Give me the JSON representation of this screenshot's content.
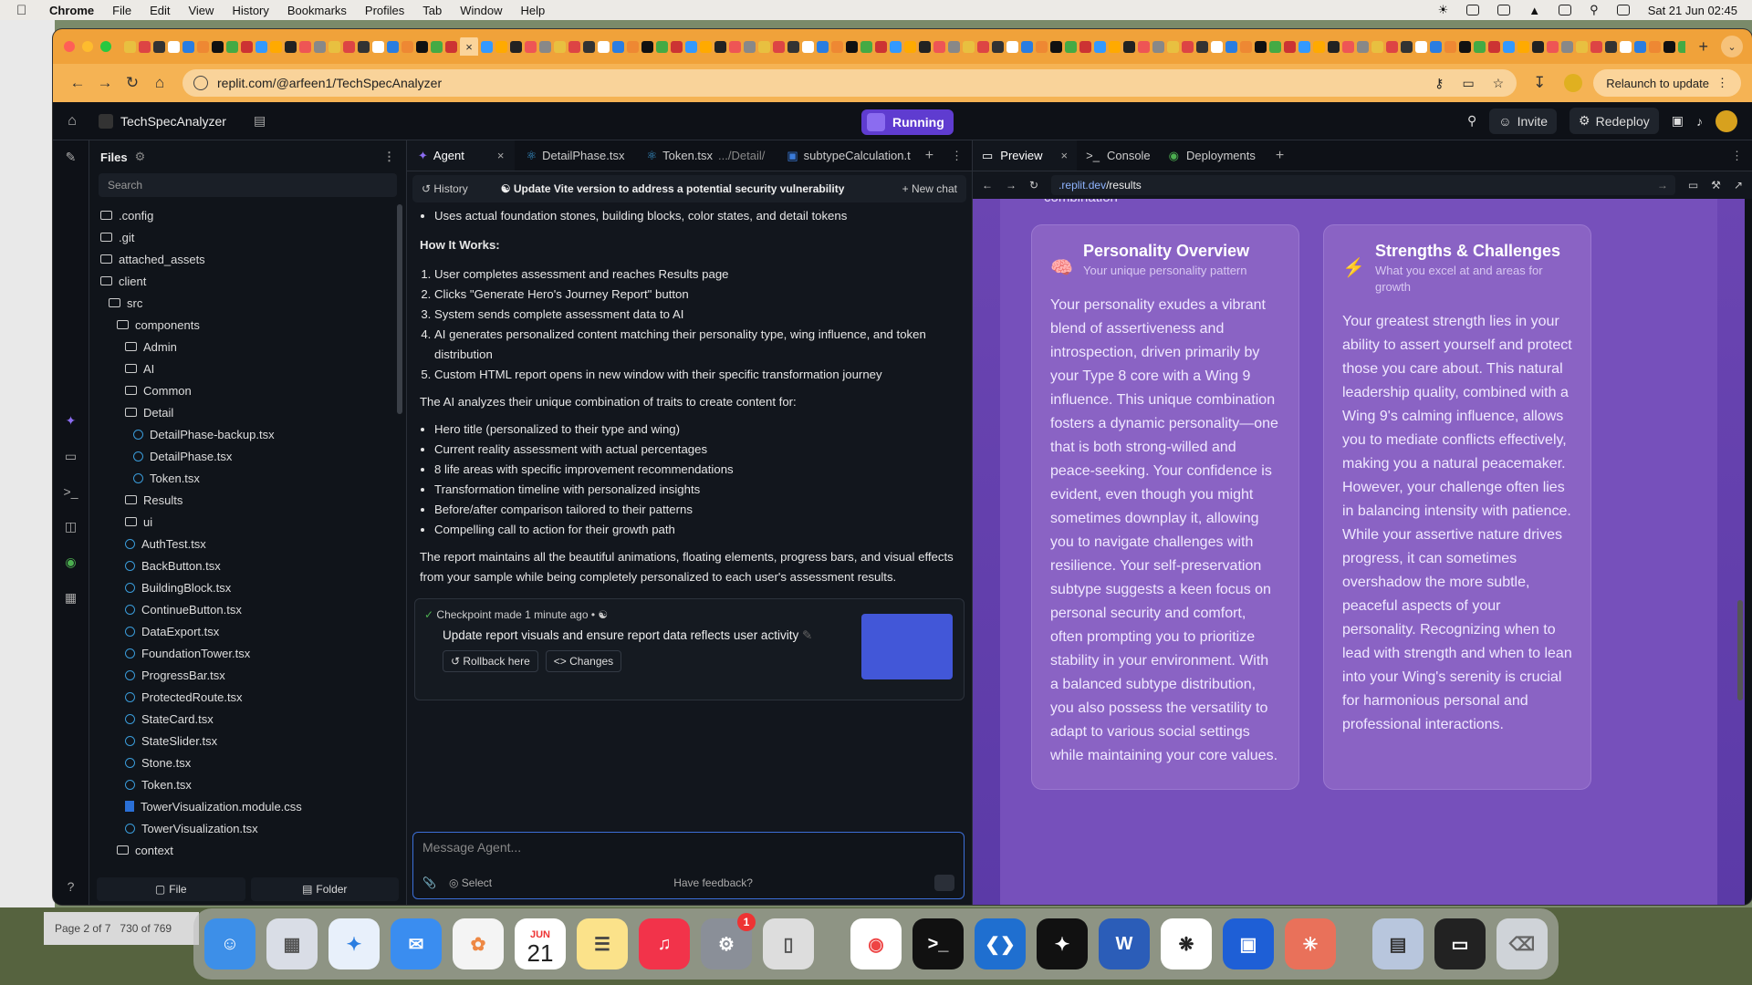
{
  "menubar": {
    "app": "Chrome",
    "items": [
      "File",
      "Edit",
      "View",
      "History",
      "Bookmarks",
      "Profiles",
      "Tab",
      "Window",
      "Help"
    ],
    "datetime": "Sat 21 Jun  02:45"
  },
  "browser": {
    "url_prefix": "replit.com/",
    "url_path": "@arfeen1/TechSpecAnalyzer",
    "relaunch_label": "Relaunch to update"
  },
  "replit": {
    "project_name": "TechSpecAnalyzer",
    "status": "Running",
    "invite_label": "Invite",
    "redeploy_label": "Redeploy"
  },
  "files": {
    "header": "Files",
    "search_placeholder": "Search",
    "tree": [
      {
        "name": ".config",
        "type": "folder",
        "depth": 0
      },
      {
        "name": ".git",
        "type": "folder",
        "depth": 0
      },
      {
        "name": "attached_assets",
        "type": "folder",
        "depth": 0
      },
      {
        "name": "client",
        "type": "folder",
        "depth": 0
      },
      {
        "name": "src",
        "type": "folder",
        "depth": 1
      },
      {
        "name": "components",
        "type": "folder",
        "depth": 2
      },
      {
        "name": "Admin",
        "type": "folder",
        "depth": 3
      },
      {
        "name": "AI",
        "type": "folder",
        "depth": 3
      },
      {
        "name": "Common",
        "type": "folder",
        "depth": 3
      },
      {
        "name": "Detail",
        "type": "folder",
        "depth": 3
      },
      {
        "name": "DetailPhase-backup.tsx",
        "type": "tsx",
        "depth": 4
      },
      {
        "name": "DetailPhase.tsx",
        "type": "tsx",
        "depth": 4
      },
      {
        "name": "Token.tsx",
        "type": "tsx",
        "depth": 4
      },
      {
        "name": "Results",
        "type": "folder",
        "depth": 3
      },
      {
        "name": "ui",
        "type": "folder",
        "depth": 3
      },
      {
        "name": "AuthTest.tsx",
        "type": "tsx",
        "depth": 3
      },
      {
        "name": "BackButton.tsx",
        "type": "tsx",
        "depth": 3
      },
      {
        "name": "BuildingBlock.tsx",
        "type": "tsx",
        "depth": 3
      },
      {
        "name": "ContinueButton.tsx",
        "type": "tsx",
        "depth": 3
      },
      {
        "name": "DataExport.tsx",
        "type": "tsx",
        "depth": 3
      },
      {
        "name": "FoundationTower.tsx",
        "type": "tsx",
        "depth": 3
      },
      {
        "name": "ProgressBar.tsx",
        "type": "tsx",
        "depth": 3
      },
      {
        "name": "ProtectedRoute.tsx",
        "type": "tsx",
        "depth": 3
      },
      {
        "name": "StateCard.tsx",
        "type": "tsx",
        "depth": 3
      },
      {
        "name": "StateSlider.tsx",
        "type": "tsx",
        "depth": 3
      },
      {
        "name": "Stone.tsx",
        "type": "tsx",
        "depth": 3
      },
      {
        "name": "Token.tsx",
        "type": "tsx",
        "depth": 3
      },
      {
        "name": "TowerVisualization.module.css",
        "type": "css",
        "depth": 3
      },
      {
        "name": "TowerVisualization.tsx",
        "type": "tsx",
        "depth": 3
      },
      {
        "name": "context",
        "type": "folder",
        "depth": 2
      }
    ],
    "new_file": "File",
    "new_folder": "Folder"
  },
  "editor_tabs": {
    "agent": "Agent",
    "t1": "DetailPhase.tsx",
    "t2": "Token.tsx",
    "t2_path": ".../Detail/",
    "t3": "subtypeCalculation.t"
  },
  "agent": {
    "history": "History",
    "title": "Update Vite version to address a potential security vulnerability",
    "new_chat": "+ New chat",
    "bullet_top": "Uses actual foundation stones, building blocks, color states, and detail tokens",
    "how_heading": "How It Works:",
    "steps": [
      "User completes assessment and reaches Results page",
      "Clicks \"Generate Hero's Journey Report\" button",
      "System sends complete assessment data to AI",
      "AI generates personalized content matching their personality type, wing influence, and token distribution",
      "Custom HTML report opens in new window with their specific transformation journey"
    ],
    "analyzes": "The AI analyzes their unique combination of traits to create content for:",
    "bullets": [
      "Hero title (personalized to their type and wing)",
      "Current reality assessment with actual percentages",
      "8 life areas with specific improvement recommendations",
      "Transformation timeline with personalized insights",
      "Before/after comparison tailored to their patterns",
      "Compelling call to action for their growth path"
    ],
    "closing": "The report maintains all the beautiful animations, floating elements, progress bars, and visual effects from your sample while being completely personalized to each user's assessment results.",
    "checkpoint_label": "Checkpoint made 1 minute ago",
    "checkpoint_dot": "•",
    "checkpoint_msg": "Update report visuals and ensure report data reflects user activity",
    "rollback": "Rollback here",
    "changes": "Changes",
    "input_placeholder": "Message Agent...",
    "select_label": "Select",
    "feedback": "Have feedback?"
  },
  "preview": {
    "tab_preview": "Preview",
    "tab_console": "Console",
    "tab_deployments": "Deployments",
    "url_host": ".replit.dev",
    "url_path": "/results",
    "cut_text": "combination",
    "cards": [
      {
        "icon": "🧠",
        "title": "Personality Overview",
        "subtitle": "Your unique personality pattern",
        "text": "Your personality exudes a vibrant blend of assertiveness and introspection, driven primarily by your Type 8 core with a Wing 9 influence. This unique combination fosters a dynamic personality—one that is both strong-willed and peace-seeking. Your confidence is evident, even though you might sometimes downplay it, allowing you to navigate challenges with resilience. Your self-preservation subtype suggests a keen focus on personal security and comfort, often prompting you to prioritize stability in your environment. With a balanced subtype distribution, you also possess the versatility to adapt to various social settings while maintaining your core values."
      },
      {
        "icon": "⚡",
        "title": "Strengths & Challenges",
        "subtitle": "What you excel at and areas for growth",
        "text": "Your greatest strength lies in your ability to assert yourself and protect those you care about. This natural leadership quality, combined with a Wing 9's calming influence, allows you to mediate conflicts effectively, making you a natural peacemaker. However, your challenge often lies in balancing intensity with patience. While your assertive nature drives progress, it can sometimes overshadow the more subtle, peaceful aspects of your personality. Recognizing when to lead with strength and when to lean into your Wing's serenity is crucial for harmonious personal and professional interactions."
      }
    ]
  },
  "finder": {
    "page_info": "Page 2 of 7",
    "count": "730 of 769"
  },
  "dock": {
    "calendar_month": "JUN",
    "calendar_day": "21",
    "settings_badge": "1"
  }
}
